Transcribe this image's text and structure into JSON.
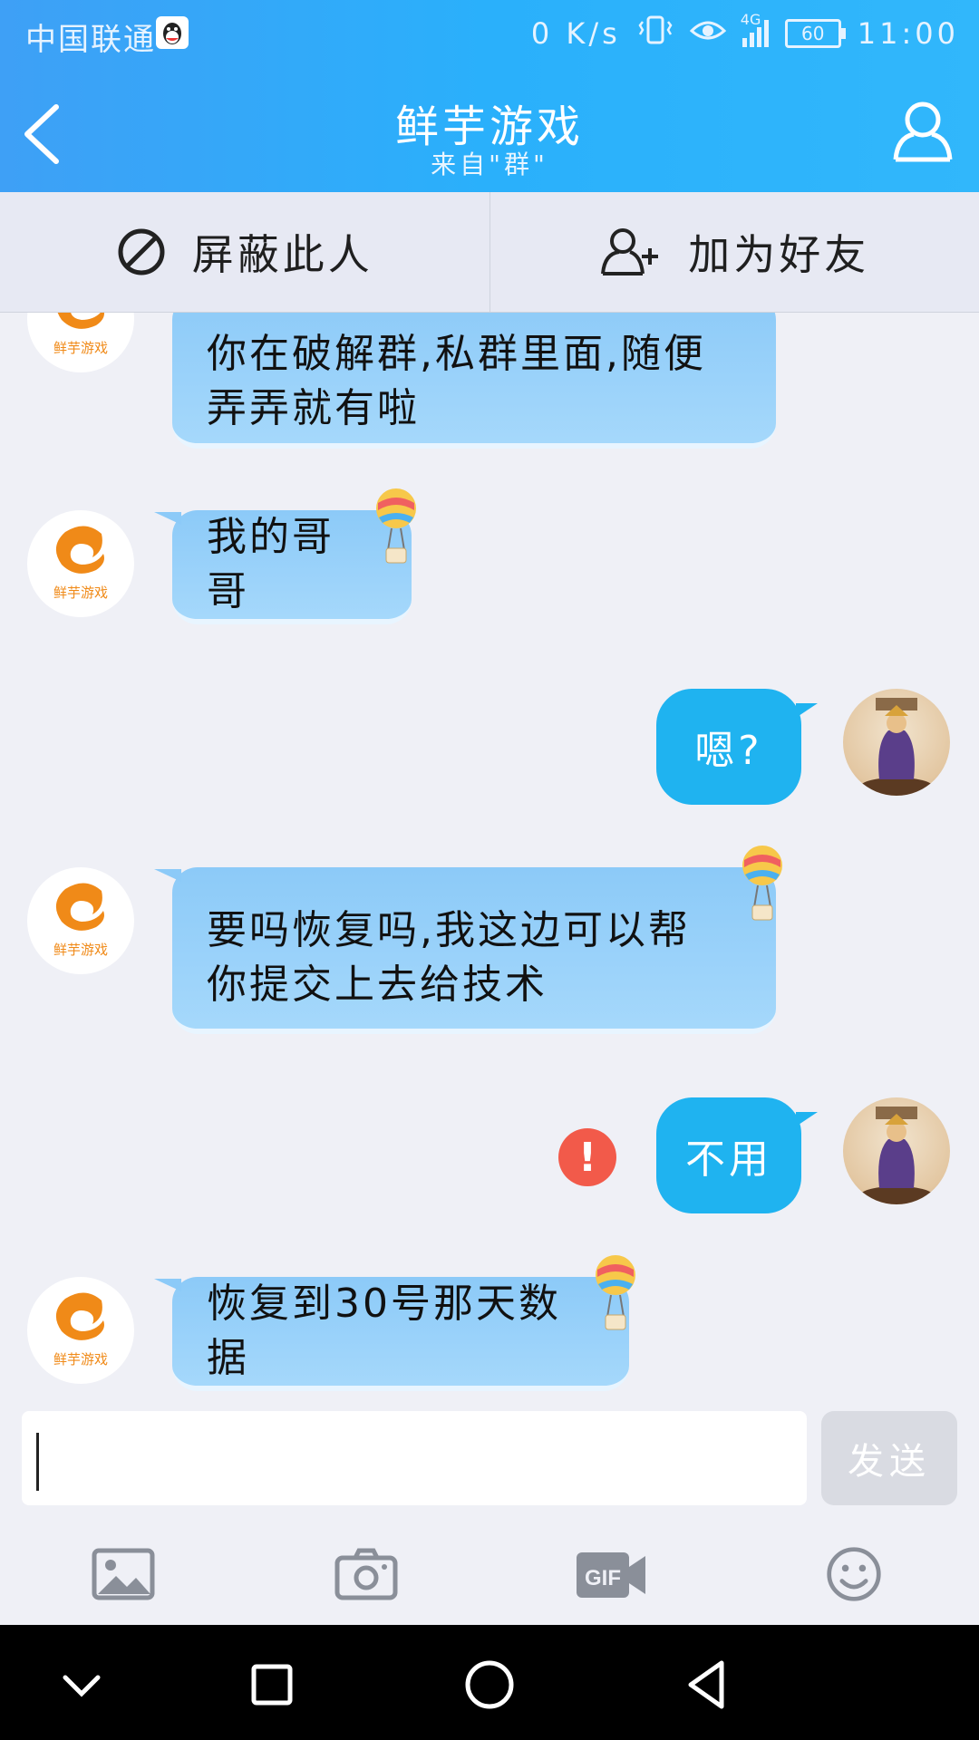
{
  "status_bar": {
    "carrier": "中国联通",
    "net_speed": "0 K/s",
    "network": "4G",
    "battery": "60",
    "time": "11:00"
  },
  "header": {
    "title": "鲜芋游戏",
    "subtitle": "来自\"群\""
  },
  "actions": {
    "block_label": "屏蔽此人",
    "add_friend_label": "加为好友"
  },
  "contact": {
    "logo_text": "鲜芋游戏"
  },
  "messages": [
    {
      "from": "them",
      "lines": [
        "你在破解群,私群里面,随便",
        "弄弄就有啦"
      ]
    },
    {
      "from": "them",
      "lines": [
        "我的哥哥"
      ]
    },
    {
      "from": "me",
      "text": "嗯?",
      "failed": false
    },
    {
      "from": "them",
      "lines": [
        "要吗恢复吗,我这边可以帮",
        "你提交上去给技术"
      ]
    },
    {
      "from": "me",
      "text": "不用",
      "failed": true,
      "error_symbol": "!"
    },
    {
      "from": "them",
      "lines": [
        "恢复到30号那天数据"
      ]
    }
  ],
  "input": {
    "value": "",
    "send_label": "发送"
  },
  "toolbar": [
    "image-icon",
    "camera-icon",
    "gif-icon",
    "emoji-icon"
  ],
  "colors": {
    "header": "#2ab0fb",
    "incoming_bubble": "#a5d8fb",
    "outgoing_bubble": "#1fb3f0",
    "error": "#f25a4a"
  }
}
